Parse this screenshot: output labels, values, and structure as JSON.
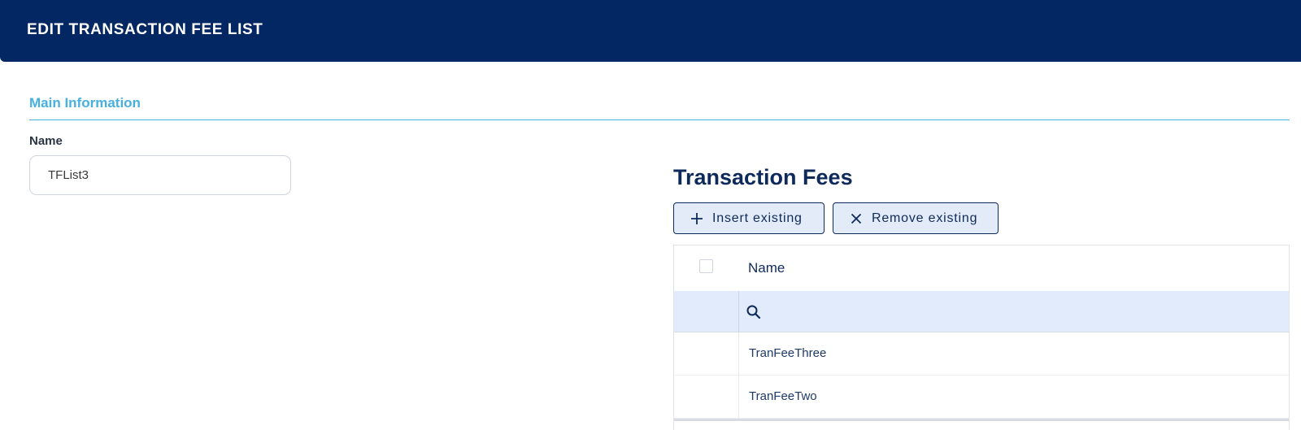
{
  "header": {
    "title": "EDIT TRANSACTION FEE LIST"
  },
  "main_information": {
    "section_title": "Main Information",
    "name_label": "Name",
    "name_value": "TFList3"
  },
  "transaction_fees": {
    "title": "Transaction Fees",
    "insert_button": "Insert existing",
    "remove_button": "Remove existing",
    "columns": [
      "Name"
    ],
    "rows": [
      {
        "name": "TranFeeThree"
      },
      {
        "name": "TranFeeTwo"
      }
    ]
  },
  "colors": {
    "header_bg": "#022762",
    "section_accent": "#46b0e0",
    "button_bg": "#e3ebf9",
    "filter_row_bg": "#e1ebfb"
  },
  "icons": {
    "insert": "plus-icon",
    "remove": "close-icon",
    "filter": "search-icon"
  }
}
